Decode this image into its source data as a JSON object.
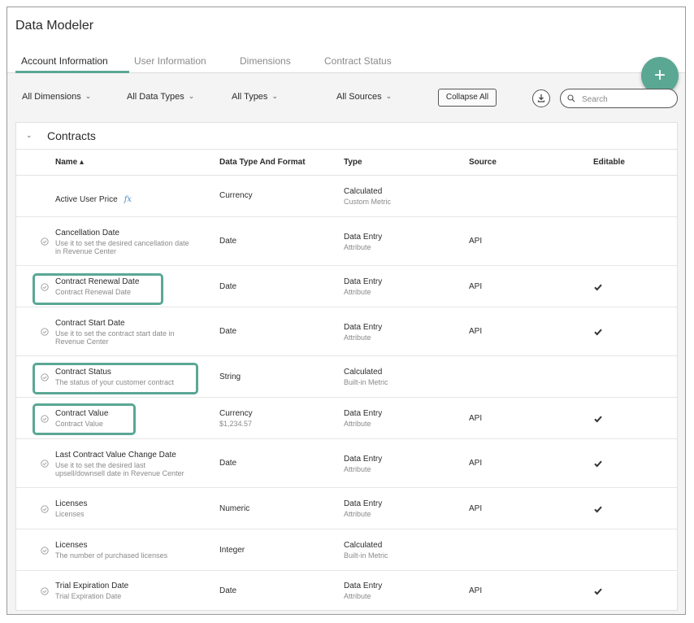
{
  "app": {
    "title": "Data Modeler"
  },
  "tabs": [
    {
      "label": "Account Information",
      "active": true
    },
    {
      "label": "User Information",
      "active": false
    },
    {
      "label": "Dimensions",
      "active": false
    },
    {
      "label": "Contract Status",
      "active": false
    }
  ],
  "fab": {
    "label": "+"
  },
  "toolbar": {
    "filters": [
      "All Dimensions",
      "All Data Types",
      "All Types",
      "All Sources"
    ],
    "collapse_label": "Collapse All",
    "search_placeholder": "Search"
  },
  "section": {
    "title": "Contracts"
  },
  "columns": {
    "name": "Name ▴",
    "data_type": "Data Type And Format",
    "type": "Type",
    "source": "Source",
    "editable": "Editable"
  },
  "rows": [
    {
      "name": "Active User Price",
      "description": "",
      "formula_icon": "fx",
      "data_type": "Currency",
      "data_format": "",
      "type": "Calculated",
      "subtype": "Custom Metric",
      "source": "",
      "editable": false,
      "highlighted": false
    },
    {
      "name": "Cancellation Date",
      "description": "Use it to set the desired cancellation date\nin Revenue Center",
      "data_type": "Date",
      "data_format": "",
      "type": "Data Entry",
      "subtype": "Attribute",
      "source": "API",
      "editable": false,
      "highlighted": false
    },
    {
      "name": "Contract Renewal Date",
      "description": "Contract Renewal Date",
      "data_type": "Date",
      "data_format": "",
      "type": "Data Entry",
      "subtype": "Attribute",
      "source": "API",
      "editable": true,
      "highlighted": true
    },
    {
      "name": "Contract Start Date",
      "description": "Use it to set the contract start date in\nRevenue Center",
      "data_type": "Date",
      "data_format": "",
      "type": "Data Entry",
      "subtype": "Attribute",
      "source": "API",
      "editable": true,
      "highlighted": false
    },
    {
      "name": "Contract Status",
      "description": "The status of your customer contract",
      "data_type": "String",
      "data_format": "",
      "type": "Calculated",
      "subtype": "Built-in Metric",
      "source": "",
      "editable": false,
      "highlighted": true
    },
    {
      "name": "Contract Value",
      "description": "Contract Value",
      "data_type": "Currency",
      "data_format": "$1,234.57",
      "type": "Data Entry",
      "subtype": "Attribute",
      "source": "API",
      "editable": true,
      "highlighted": true
    },
    {
      "name": "Last Contract Value Change Date",
      "description": "Use it to set the desired last\nupsell/downsell date in Revenue Center",
      "data_type": "Date",
      "data_format": "",
      "type": "Data Entry",
      "subtype": "Attribute",
      "source": "API",
      "editable": true,
      "highlighted": false
    },
    {
      "name": "Licenses",
      "description": "Licenses",
      "data_type": "Numeric",
      "data_format": "",
      "type": "Data Entry",
      "subtype": "Attribute",
      "source": "API",
      "editable": true,
      "highlighted": false
    },
    {
      "name": "Licenses",
      "description": "The number of purchased licenses",
      "data_type": "Integer",
      "data_format": "",
      "type": "Calculated",
      "subtype": "Built-in Metric",
      "source": "",
      "editable": false,
      "highlighted": false
    },
    {
      "name": "Trial Expiration Date",
      "description": "Trial Expiration Date",
      "data_type": "Date",
      "data_format": "",
      "type": "Data Entry",
      "subtype": "Attribute",
      "source": "API",
      "editable": true,
      "highlighted": false
    }
  ],
  "icons": {
    "status": "circle-check-icon",
    "editable": "checkmark-icon",
    "download": "download-icon",
    "search": "search-icon",
    "expand": "chevron-down-icon"
  },
  "colors": {
    "accent": "#5aa794",
    "formula": "#4a8fc7"
  }
}
